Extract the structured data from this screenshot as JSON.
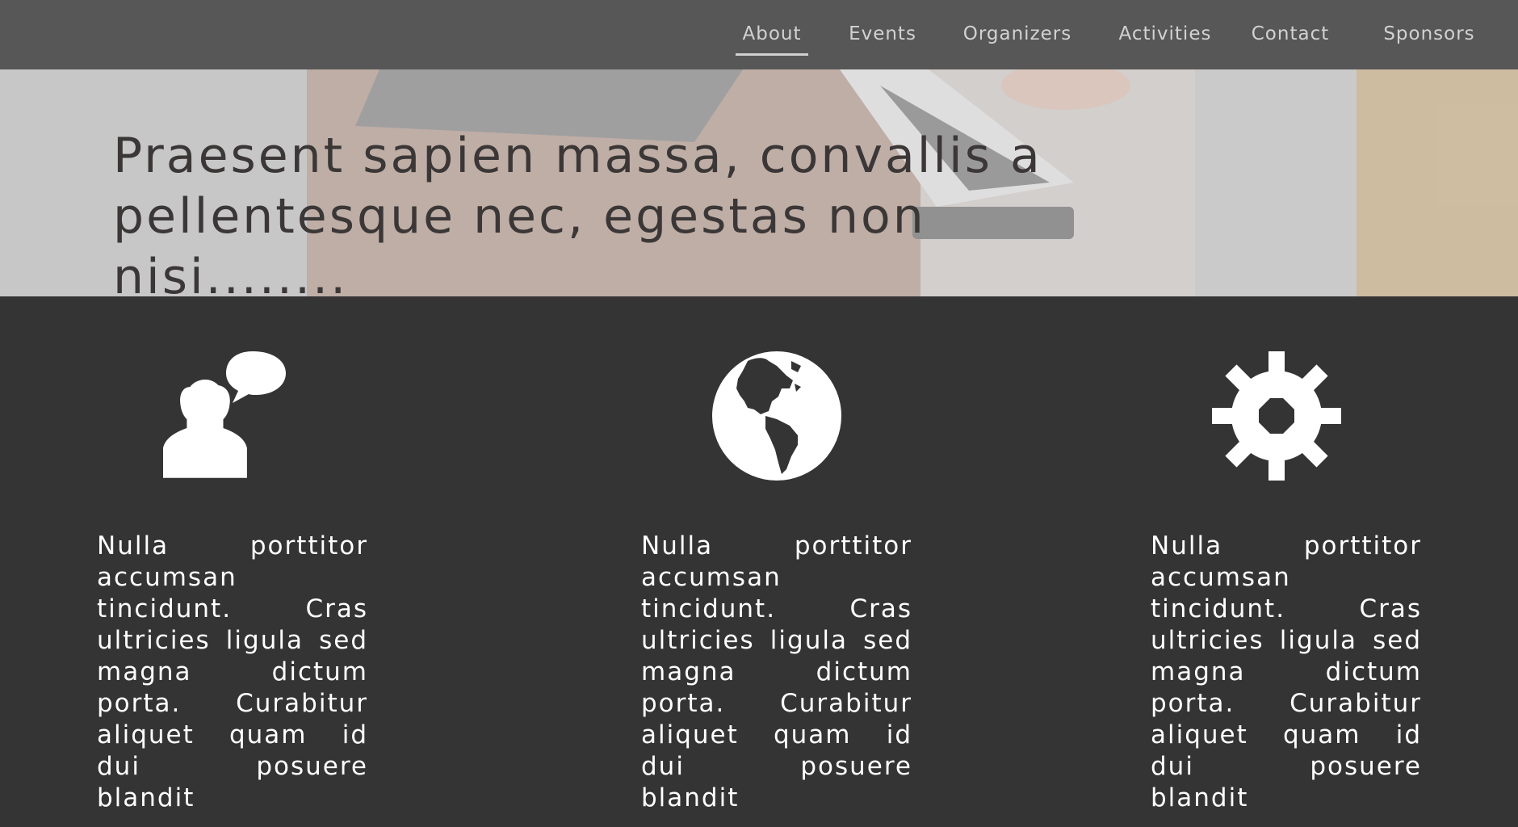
{
  "nav": {
    "items": [
      {
        "label": "About",
        "active": true
      },
      {
        "label": "Events",
        "active": false
      },
      {
        "label": "Organizers",
        "active": false
      },
      {
        "label": "Activities",
        "active": false
      },
      {
        "label": "Contact",
        "active": false
      },
      {
        "label": "Sponsors",
        "active": false
      }
    ]
  },
  "hero": {
    "title_line1": "Praesent sapien massa, convallis a",
    "title_line2": "pellentesque nec, egestas non nisi........"
  },
  "features": [
    {
      "icon": "person-speech-icon",
      "text": "Nulla porttitor accumsan tincidunt. Cras ultricies ligula sed magna dictum porta. Curabitur aliquet quam id dui posuere blandit"
    },
    {
      "icon": "globe-icon",
      "text": "Nulla porttitor accumsan tincidunt. Cras ultricies ligula sed magna dictum porta. Curabitur aliquet quam id dui posuere blandit"
    },
    {
      "icon": "gear-icon",
      "text": "Nulla porttitor accumsan tincidunt. Cras ultricies ligula sed magna dictum porta. Curabitur aliquet quam id dui posuere blandit"
    }
  ],
  "colors": {
    "nav_bg": "#575757",
    "features_bg": "#343434",
    "hero_title": "#3b3737",
    "text": "#ffffff"
  }
}
